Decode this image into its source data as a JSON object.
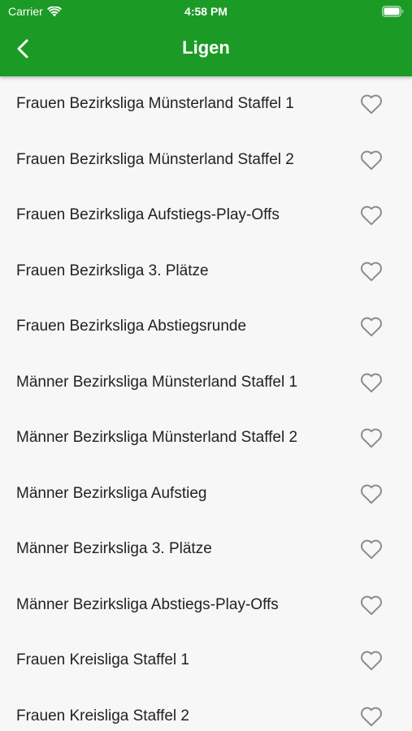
{
  "status_bar": {
    "carrier": "Carrier",
    "time": "4:58 PM"
  },
  "header": {
    "title": "Ligen",
    "back_icon": "chevron-left-icon",
    "background_color": "#1b9b26"
  },
  "leagues": [
    {
      "name": "Frauen Bezirksliga Münsterland Staffel 1",
      "favorite_icon": "heart-outline-icon"
    },
    {
      "name": "Frauen Bezirksliga Münsterland Staffel 2",
      "favorite_icon": "heart-outline-icon"
    },
    {
      "name": "Frauen Bezirksliga Aufstiegs-Play-Offs",
      "favorite_icon": "heart-outline-icon"
    },
    {
      "name": "Frauen Bezirksliga 3. Plätze",
      "favorite_icon": "heart-outline-icon"
    },
    {
      "name": "Frauen Bezirksliga Abstiegsrunde",
      "favorite_icon": "heart-outline-icon"
    },
    {
      "name": "Männer Bezirksliga Münsterland Staffel 1",
      "favorite_icon": "heart-outline-icon"
    },
    {
      "name": "Männer Bezirksliga Münsterland Staffel 2",
      "favorite_icon": "heart-outline-icon"
    },
    {
      "name": "Männer Bezirksliga Aufstieg",
      "favorite_icon": "heart-outline-icon"
    },
    {
      "name": "Männer Bezirksliga 3. Plätze",
      "favorite_icon": "heart-outline-icon"
    },
    {
      "name": "Männer Bezirksliga Abstiegs-Play-Offs",
      "favorite_icon": "heart-outline-icon"
    },
    {
      "name": "Frauen Kreisliga Staffel 1",
      "favorite_icon": "heart-outline-icon"
    },
    {
      "name": "Frauen Kreisliga Staffel 2",
      "favorite_icon": "heart-outline-icon"
    }
  ]
}
